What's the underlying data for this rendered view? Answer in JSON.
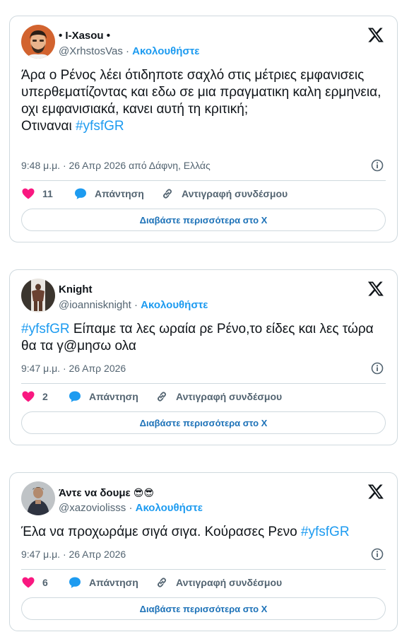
{
  "tweets": [
    {
      "display_name": "• I-Xasou •",
      "handle": "@XrhstosVas",
      "follow_label": "Ακολουθήστε",
      "text": "Άρα ο Ρένος λέει ότιδηποτε σαχλό στις μέτριες εμφανισεις υπερθεματίζοντας και εδω σε μια πραγματικη καλη ερμηνεια, οχι εμφανισιακά, κανει αυτή τη κριτική;\nΟτιναναι ",
      "hashtag": "#yfsfGR",
      "timestamp": "9:48 μ.μ. · 26 Απρ 2026 από Δάφνη, Ελλάς",
      "likes": "11",
      "reply_label": "Απάντηση",
      "copy_label": "Αντιγραφή συνδέσμου",
      "read_more": "Διαβάστε περισσότερα στο X"
    },
    {
      "display_name": "Knight",
      "handle": "@ioannisknight",
      "follow_label": "Ακολουθήστε",
      "hashtag": "#yfsfGR",
      "text": " Είπαμε τα λες ωραία ρε Ρένο,το είδες και λες τώρα θα τα γ@μησω ολα",
      "timestamp": "9:47 μ.μ. · 26 Απρ 2026",
      "likes": "2",
      "reply_label": "Απάντηση",
      "copy_label": "Αντιγραφή συνδέσμου",
      "read_more": "Διαβάστε περισσότερα στο X"
    },
    {
      "display_name": "Άντε να δουμε",
      "display_emoji": "😎😎",
      "handle": "@xazoviolisss",
      "follow_label": "Ακολουθήστε",
      "text": "Έλα να προχωράμε σιγά σιγα. Κούρασες Ρενο ",
      "hashtag": "#yfsfGR",
      "timestamp": "9:47 μ.μ. · 26 Απρ 2026",
      "likes": "6",
      "reply_label": "Απάντηση",
      "copy_label": "Αντιγραφή συνδέσμου",
      "read_more": "Διαβάστε περισσότερα στο X"
    }
  ],
  "colors": {
    "accent": "#1d9bf0",
    "like": "#f91880",
    "muted": "#536471",
    "border": "#cfd9de"
  },
  "icons": [
    "x-logo-icon",
    "info-icon",
    "heart-icon",
    "reply-bubble-icon",
    "link-icon"
  ]
}
